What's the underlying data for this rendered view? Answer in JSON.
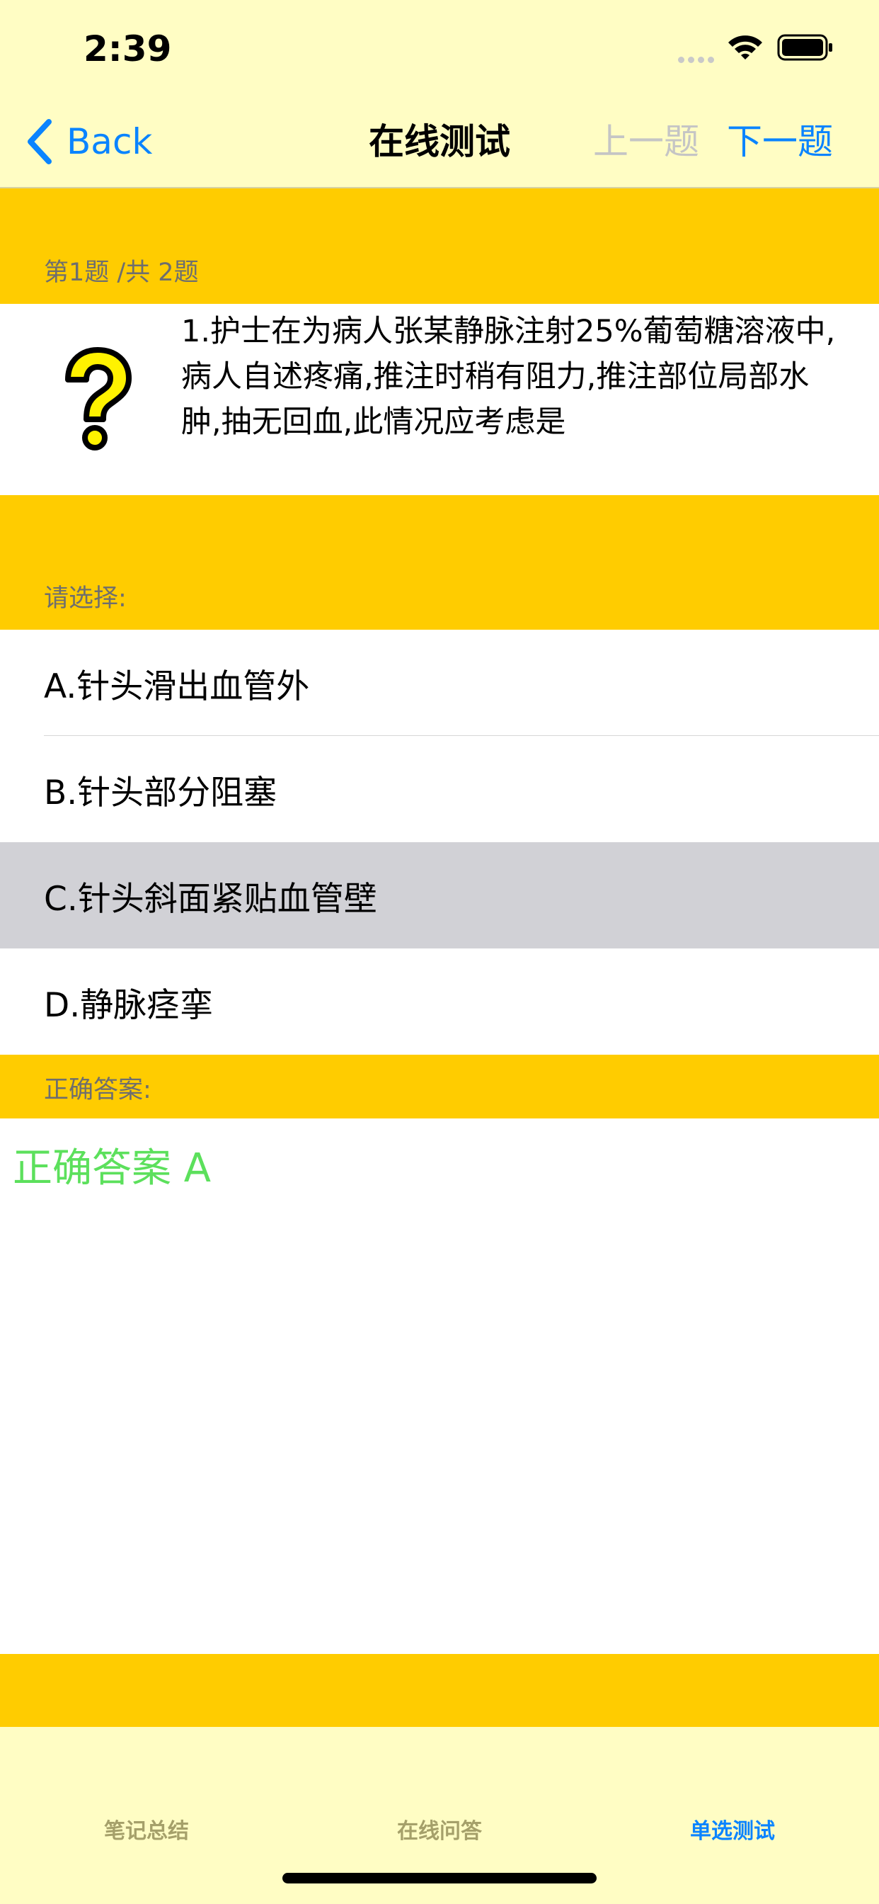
{
  "status_bar": {
    "time": "2:39"
  },
  "nav": {
    "back_label": "Back",
    "title": "在线测试",
    "prev_label": "上一题",
    "next_label": "下一题"
  },
  "progress": {
    "label": "第1题 /共 2题"
  },
  "question": {
    "text": "1.护士在为病人张某静脉注射25%葡萄糖溶液中,病人自述疼痛,推注时稍有阻力,推注部位局部水肿,抽无回血,此情况应考虑是",
    "icon": "question-mark-icon"
  },
  "choose": {
    "label": "请选择:"
  },
  "options": [
    {
      "text": "A.针头滑出血管外"
    },
    {
      "text": "B.针头部分阻塞"
    },
    {
      "text": "C.针头斜面紧贴血管壁",
      "selected": true
    },
    {
      "text": "D.静脉痉挛"
    }
  ],
  "answer": {
    "section_label": "正确答案:",
    "text": "正确答案 A"
  },
  "tabs": [
    {
      "label": "笔记总结"
    },
    {
      "label": "在线问答"
    },
    {
      "label": "单选测试",
      "active": true
    }
  ],
  "colors": {
    "accent": "#0A84FF",
    "section_yellow": "#FFCC00",
    "bar_background": "#FFFDC4",
    "answer_green": "#5CE05C",
    "selected_gray": "#D1D1D6"
  }
}
